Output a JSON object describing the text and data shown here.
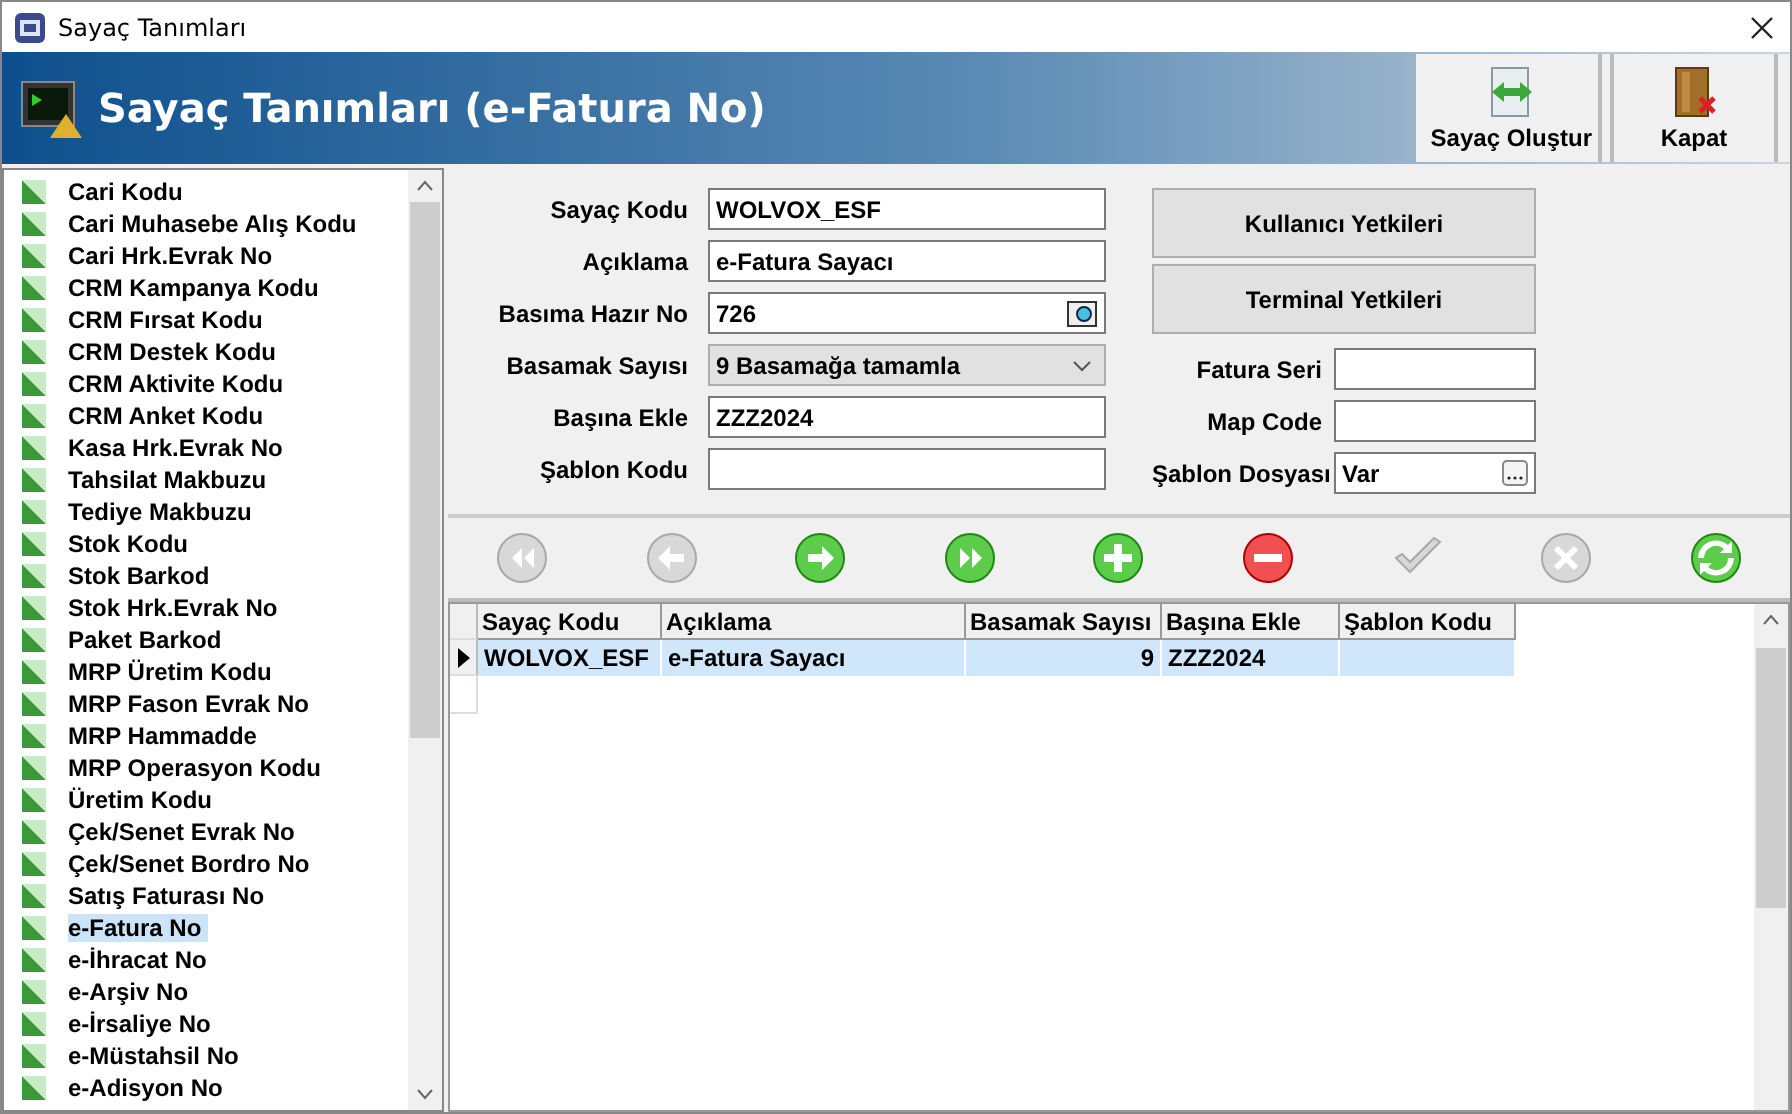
{
  "window": {
    "title": "Sayaç Tanımları"
  },
  "header": {
    "title": "Sayaç Tanımları (e-Fatura No)",
    "buttons": [
      {
        "label": "Sayaç Oluştur",
        "kind": "create"
      },
      {
        "label": "Kapat",
        "kind": "close"
      }
    ]
  },
  "sidebar": {
    "items": [
      {
        "label": "Cari Kodu",
        "selected": false
      },
      {
        "label": "Cari Muhasebe Alış Kodu",
        "selected": false
      },
      {
        "label": "Cari Hrk.Evrak No",
        "selected": false
      },
      {
        "label": "CRM Kampanya Kodu",
        "selected": false
      },
      {
        "label": "CRM Fırsat Kodu",
        "selected": false
      },
      {
        "label": "CRM Destek Kodu",
        "selected": false
      },
      {
        "label": "CRM Aktivite Kodu",
        "selected": false
      },
      {
        "label": "CRM Anket Kodu",
        "selected": false
      },
      {
        "label": "Kasa Hrk.Evrak No",
        "selected": false
      },
      {
        "label": "Tahsilat Makbuzu",
        "selected": false
      },
      {
        "label": "Tediye Makbuzu",
        "selected": false
      },
      {
        "label": "Stok Kodu",
        "selected": false
      },
      {
        "label": "Stok Barkod",
        "selected": false
      },
      {
        "label": "Stok Hrk.Evrak No",
        "selected": false
      },
      {
        "label": "Paket Barkod",
        "selected": false
      },
      {
        "label": "MRP Üretim Kodu",
        "selected": false
      },
      {
        "label": "MRP Fason Evrak No",
        "selected": false
      },
      {
        "label": "MRP Hammadde",
        "selected": false
      },
      {
        "label": "MRP Operasyon Kodu",
        "selected": false
      },
      {
        "label": "Üretim Kodu",
        "selected": false
      },
      {
        "label": "Çek/Senet Evrak No",
        "selected": false
      },
      {
        "label": "Çek/Senet Bordro No",
        "selected": false
      },
      {
        "label": "Satış Faturası No",
        "selected": false
      },
      {
        "label": "e-Fatura No",
        "selected": true
      },
      {
        "label": "e-İhracat No",
        "selected": false
      },
      {
        "label": "e-Arşiv No",
        "selected": false
      },
      {
        "label": "e-İrsaliye No",
        "selected": false
      },
      {
        "label": "e-Müstahsil No",
        "selected": false
      },
      {
        "label": "e-Adisyon No",
        "selected": false
      }
    ]
  },
  "form": {
    "fields": [
      {
        "label": "Sayaç Kodu",
        "value": "WOLVOX_ESF",
        "kind": "text"
      },
      {
        "label": "Açıklama",
        "value": "e-Fatura Sayacı",
        "kind": "text"
      },
      {
        "label": "Basıma Hazır No",
        "value": "726",
        "kind": "lookup"
      },
      {
        "label": "Basamak Sayısı",
        "value": "9 Basamağa tamamla",
        "kind": "dropdown"
      },
      {
        "label": "Başına Ekle",
        "value": "ZZZ2024",
        "kind": "text"
      },
      {
        "label": "Şablon Kodu",
        "kind": "text"
      }
    ],
    "buttons": [
      "Kullanıcı Yetkileri",
      "Terminal Yetkileri"
    ],
    "side_fields": [
      {
        "label": "Fatura Seri",
        "kind": "text"
      },
      {
        "label": "Map Code",
        "kind": "text"
      },
      {
        "label": "Şablon Dosyası",
        "value": "Var",
        "kind": "browse"
      }
    ]
  },
  "navigator": [
    {
      "kind": "first",
      "disabled": true
    },
    {
      "kind": "prev",
      "disabled": true
    },
    {
      "kind": "next",
      "disabled": false
    },
    {
      "kind": "last",
      "disabled": false
    },
    {
      "kind": "add",
      "disabled": false
    },
    {
      "kind": "delete",
      "disabled": false
    },
    {
      "kind": "post",
      "disabled": true
    },
    {
      "kind": "cancel",
      "disabled": true
    },
    {
      "kind": "refresh",
      "disabled": false
    }
  ],
  "table": {
    "columns": [
      "Sayaç Kodu",
      "Açıklama",
      "Basamak Sayısı",
      "Başına Ekle",
      "Şablon Kodu"
    ],
    "rows": [
      {
        "cells": [
          "WOLVOX_ESF",
          "e-Fatura Sayacı",
          "9",
          "ZZZ2024",
          ""
        ],
        "selected": true
      }
    ]
  }
}
